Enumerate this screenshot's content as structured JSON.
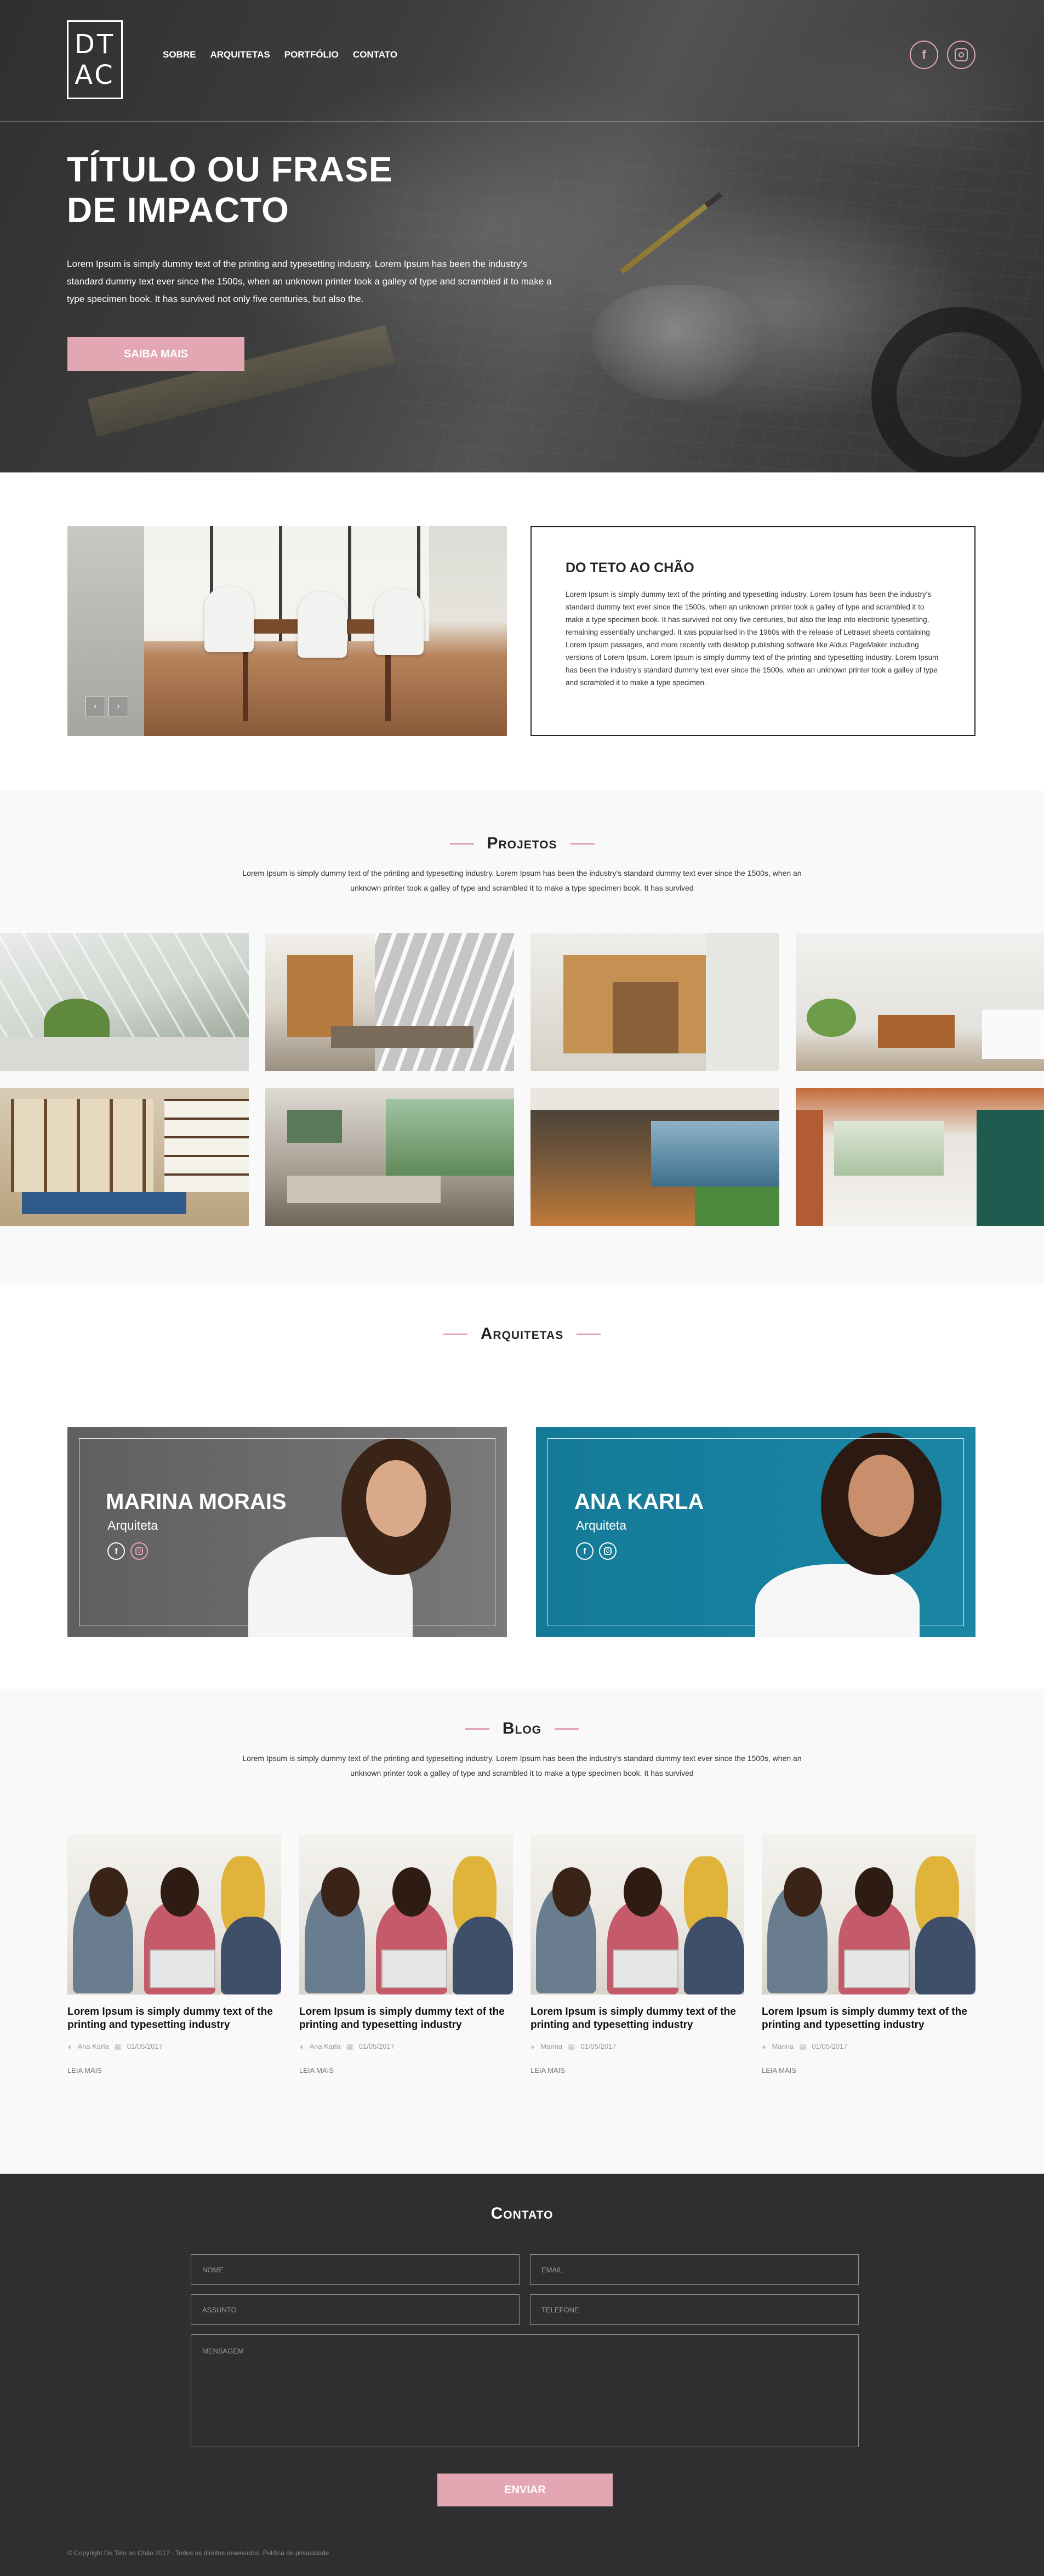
{
  "colors": {
    "accent": "#e3a7b3",
    "dark": "#2f2f31",
    "light_bg": "#f9f9f9"
  },
  "logo": {
    "line1": "DT",
    "line2": "AC"
  },
  "nav": {
    "items": [
      "SOBRE",
      "ARQUITETAS",
      "PORTFÓLIO",
      "CONTATO"
    ]
  },
  "social": {
    "facebook": "f",
    "instagram_icon": "instagram-icon"
  },
  "hero": {
    "title_line1": "TÍTULO OU FRASE",
    "title_line2": "DE IMPACTO",
    "text": "Lorem Ipsum is simply dummy text of the printing and typesetting industry. Lorem Ipsum has been the industry's standard dummy text ever since the 1500s, when an unknown printer took a galley of type and scrambled it to make a type specimen book. It has survived not only five centuries, but also the.",
    "button": "SAIBA MAIS"
  },
  "about": {
    "title": "DO TETO AO CHÃO",
    "text": "Lorem Ipsum is simply dummy text of the printing and typesetting industry. Lorem Ipsum has been the industry's standard dummy text ever since the 1500s, when an unknown printer took a galley of type and scrambled it to make a type specimen book. It has survived not only five centuries, but also the leap into electronic typesetting, remaining essentially unchanged. It was popularised in the 1960s with the release of Letraset sheets containing Lorem Ipsum passages, and more recently with desktop publishing software like Aldus PageMaker including versions of Lorem Ipsum. Lorem Ipsum is simply dummy text of the printing and typesetting industry. Lorem Ipsum has been the industry's standard dummy text ever since the 1500s, when an unknown printer took a galley of type and scrambled it to make a type specimen.",
    "slider_prev": "‹",
    "slider_next": "›"
  },
  "projects": {
    "title": "Projetos",
    "subtitle": "Lorem Ipsum is simply dummy text of the printing and typesetting industry. Lorem Ipsum has been the industry's standard dummy text ever since the 1500s, when an unknown printer took a galley of type and scrambled it to make a type specimen book. It has survived"
  },
  "architects": {
    "title": "Arquitetas",
    "people": [
      {
        "name": "MARINA MORAIS",
        "role": "Arquiteta"
      },
      {
        "name": "ANA KARLA",
        "role": "Arquiteta"
      }
    ]
  },
  "blog": {
    "title": "Blog",
    "subtitle": "Lorem Ipsum is simply dummy text of the printing and typesetting industry. Lorem Ipsum has been the industry's standard dummy text ever since the 1500s, when an unknown printer took a galley of type and scrambled it to make a type specimen book. It has survived",
    "posts": [
      {
        "title": "Lorem Ipsum is simply dummy text of the printing and typesetting industry",
        "author": "Ana Karla",
        "date": "01/05/2017",
        "more": "LEIA MAIS"
      },
      {
        "title": "Lorem Ipsum is simply dummy text of the printing and typesetting industry",
        "author": "Ana Karla",
        "date": "01/05/2017",
        "more": "LEIA MAIS"
      },
      {
        "title": "Lorem Ipsum is simply dummy text of the printing and typesetting industry",
        "author": "Marina",
        "date": "01/05/2017",
        "more": "LEIA MAIS"
      },
      {
        "title": "Lorem Ipsum is simply dummy text of the printing and typesetting industry",
        "author": "Marina",
        "date": "01/05/2017",
        "more": "LEIA MAIS"
      }
    ]
  },
  "contact": {
    "title": "Contato",
    "fields": {
      "name": "NOME",
      "email": "EMAIL",
      "subject": "ASSUNTO",
      "phone": "TELEFONE",
      "message": "MENSAGEM"
    },
    "button": "ENVIAR",
    "copyright": "© Copyright Do Teto ao Chão 2017 - Todos os direitos reservados. Política de privacidade"
  }
}
